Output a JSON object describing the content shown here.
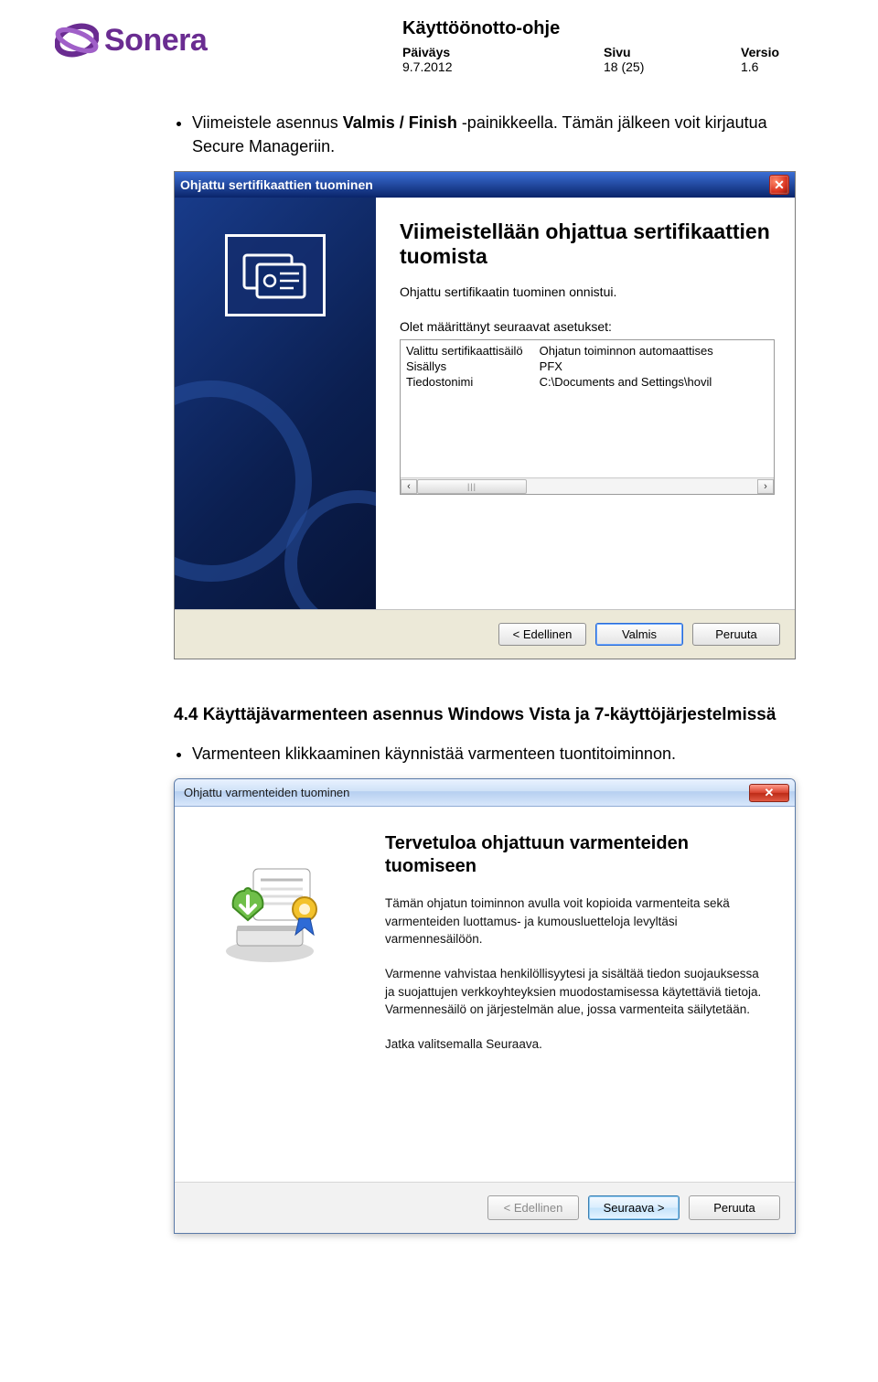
{
  "brand": {
    "name": "Sonera"
  },
  "header": {
    "doc_title": "Käyttöönotto-ohje",
    "labels": {
      "date": "Päiväys",
      "page": "Sivu",
      "version": "Versio"
    },
    "values": {
      "date": "9.7.2012",
      "page": "18 (25)",
      "version": "1.6"
    }
  },
  "bullets": {
    "b1_pre": "Viimeistele asennus ",
    "b1_bold": "Valmis / Finish",
    "b1_post": " -painikkeella. Tämän jälkeen voit kirjautua Secure Manageriin."
  },
  "xp": {
    "title": "Ohjattu sertifikaattien tuominen",
    "heading": "Viimeistellään ohjattua sertifikaattien tuomista",
    "success": "Ohjattu sertifikaatin tuominen onnistui.",
    "settings_label": "Olet määrittänyt seuraavat asetukset:",
    "rows": {
      "r1k": "Valittu sertifikaattisäilö",
      "r1v": "Ohjatun toiminnon automaattises",
      "r2k": "Sisällys",
      "r2v": "PFX",
      "r3k": "Tiedostonimi",
      "r3v": "C:\\Documents and Settings\\hovil"
    },
    "buttons": {
      "back": "< Edellinen",
      "finish": "Valmis",
      "cancel": "Peruuta"
    }
  },
  "section": {
    "heading": "4.4 Käyttäjävarmenteen asennus Windows Vista ja 7-käyttöjärjestelmissä",
    "bullet": "Varmenteen klikkaaminen käynnistää varmenteen tuontitoiminnon."
  },
  "w7": {
    "title": "Ohjattu varmenteiden tuominen",
    "heading": "Tervetuloa ohjattuun varmenteiden tuomiseen",
    "p1": "Tämän ohjatun toiminnon avulla voit kopioida varmenteita sekä varmenteiden luottamus- ja kumousluetteloja levyltäsi varmennesäilöön.",
    "p2": "Varmenne vahvistaa henkilöllisyytesi ja sisältää tiedon suojauksessa ja suojattujen verkkoyhteyksien muodostamisessa käytettäviä tietoja. Varmennesäilö on järjestelmän alue, jossa varmenteita säilytetään.",
    "p3": "Jatka valitsemalla Seuraava.",
    "buttons": {
      "back": "< Edellinen",
      "next": "Seuraava >",
      "cancel": "Peruuta"
    }
  }
}
